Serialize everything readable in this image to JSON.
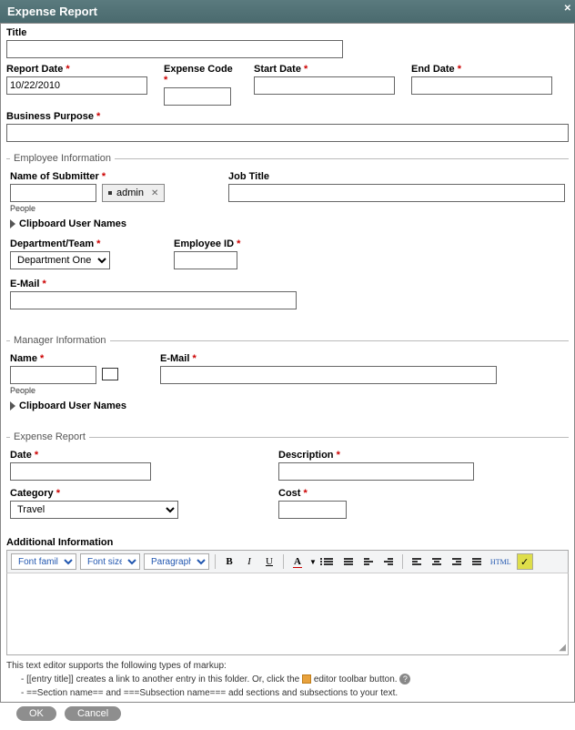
{
  "header": {
    "title": "Expense Report"
  },
  "top": {
    "title_label": "Title",
    "title_value": "",
    "report_date_label": "Report Date",
    "report_date_value": "10/22/2010",
    "expense_code_label": "Expense Code",
    "expense_code_value": "",
    "start_date_label": "Start Date",
    "start_date_value": "",
    "end_date_label": "End Date",
    "end_date_value": "",
    "business_purpose_label": "Business Purpose",
    "business_purpose_value": ""
  },
  "emp": {
    "legend": "Employee Information",
    "name_label": "Name of Submitter",
    "name_value": "",
    "people_hint": "People",
    "chip_label": "admin",
    "clipboard_label": "Clipboard User Names",
    "job_title_label": "Job Title",
    "job_title_value": "",
    "dept_label": "Department/Team",
    "dept_options": [
      "Department One"
    ],
    "dept_value": "Department One",
    "emp_id_label": "Employee ID",
    "emp_id_value": "",
    "email_label": "E-Mail",
    "email_value": ""
  },
  "mgr": {
    "legend": "Manager Information",
    "name_label": "Name",
    "name_value": "",
    "people_hint": "People",
    "clipboard_label": "Clipboard User Names",
    "email_label": "E-Mail",
    "email_value": ""
  },
  "exp": {
    "legend": "Expense Report",
    "date_label": "Date",
    "date_value": "",
    "desc_label": "Description",
    "desc_value": "",
    "cat_label": "Category",
    "cat_options": [
      "Travel"
    ],
    "cat_value": "Travel",
    "cost_label": "Cost",
    "cost_value": ""
  },
  "editor": {
    "section_label": "Additional Information",
    "font_family_label": "Font family",
    "font_size_label": "Font size",
    "format_label": "Paragraph",
    "html_label": "HTML"
  },
  "help": {
    "intro": "This text editor supports the following types of markup:",
    "l1a": "- [[entry title]] creates a link to another entry in this folder. Or, click the ",
    "l1b": " editor toolbar button. ",
    "l2": "- ==Section name== and ===Subsection name=== add sections and subsections to your text."
  },
  "buttons": {
    "ok": "OK",
    "cancel": "Cancel"
  }
}
